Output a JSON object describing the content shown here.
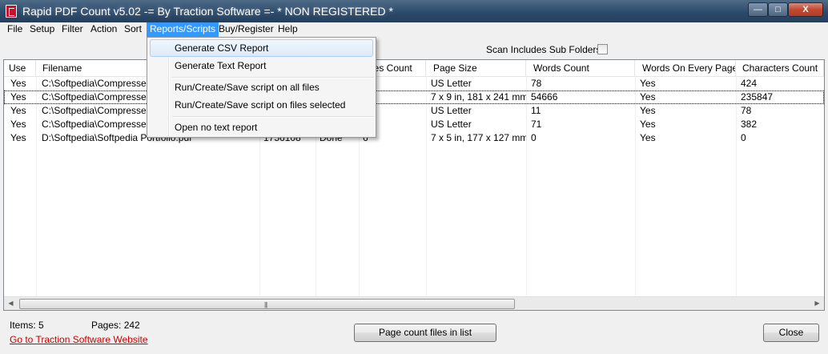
{
  "window": {
    "title": "Rapid PDF Count v5.02 -= By Traction Software =- * NON REGISTERED *",
    "minimize": "—",
    "maximize": "□",
    "close": "X"
  },
  "menubar": {
    "items": [
      "File",
      "Setup",
      "Filter",
      "Action",
      "Sort",
      "Reports/Scripts",
      "Buy/Register",
      "Help"
    ],
    "active": "Reports/Scripts"
  },
  "dropdown": {
    "items": [
      "Generate CSV Report",
      "Generate Text Report",
      "Run/Create/Save script on all files",
      "Run/Create/Save script on files selected",
      "Open no text report"
    ]
  },
  "toolbar": {
    "scan_label": "Scan Includes Sub Folders",
    "scan_checked": false
  },
  "grid": {
    "columns": [
      "Use",
      "Filename",
      "",
      "",
      "ges Count",
      "Page Size",
      "Words Count",
      "Words On Every Page",
      "Characters Count"
    ],
    "rows": [
      [
        "Yes",
        "C:\\Softpedia\\Compressed F",
        "",
        "",
        "",
        "US Letter",
        "78",
        "Yes",
        "424"
      ],
      [
        "Yes",
        "C:\\Softpedia\\Compressed F",
        "",
        "",
        "5",
        "7 x 9 in, 181 x 241 mm",
        "54666",
        "Yes",
        "235847"
      ],
      [
        "Yes",
        "C:\\Softpedia\\Compressed F",
        "",
        "",
        "",
        "US Letter",
        "11",
        "Yes",
        "78"
      ],
      [
        "Yes",
        "C:\\Softpedia\\Compressed F",
        "",
        "",
        "",
        "US Letter",
        "71",
        "Yes",
        "382"
      ],
      [
        "Yes",
        "D:\\Softpedia\\Softpedia Portfolio.pdf",
        "1756108",
        "Done",
        "6",
        "7 x 5 in, 177 x 127 mm",
        "0",
        "Yes",
        "0"
      ]
    ],
    "scroll_left": "◀",
    "scroll_right": "▶",
    "scroll_grip": "|||"
  },
  "status": {
    "items": "Items:  5",
    "pages": "Pages: 242",
    "link": "Go to Traction Software Website",
    "count_button": "Page count files in list",
    "close_button": "Close"
  }
}
